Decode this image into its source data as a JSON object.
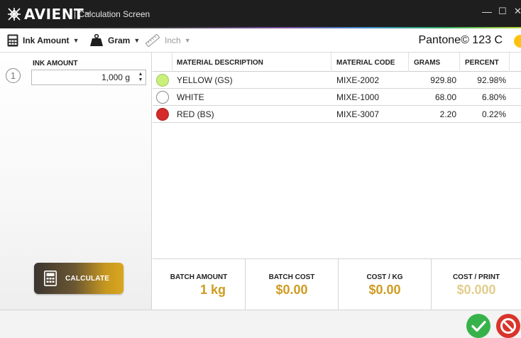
{
  "window": {
    "brand": "AVIENT",
    "trademark": "™",
    "title": "| Calculation Screen",
    "minimize_glyph": "—",
    "maximize_glyph": "☐",
    "close_glyph": "✕"
  },
  "toolbar": {
    "ink_amount_label": "Ink Amount",
    "unit_label": "Gram",
    "measure_label": "Inch",
    "pantone_label": "Pantone© 123 C",
    "pantone_color": "#ffc20e",
    "icons": [
      "calculator-icon",
      "weight-icon",
      "ruler-icon"
    ]
  },
  "left_panel": {
    "step_number": "1",
    "ink_amount_caption": "INK AMOUNT",
    "ink_amount_value": "1,000 g",
    "calculate_label": "CALCULATE"
  },
  "table": {
    "headers": {
      "description": "MATERIAL DESCRIPTION",
      "code": "MATERIAL CODE",
      "grams": "GRAMS",
      "percent": "PERCENT"
    },
    "rows": [
      {
        "color": "#c8f07a",
        "border": "#a8c860",
        "description": "YELLOW (GS)",
        "code": "MIXE-2002",
        "grams": "929.80",
        "percent": "92.98%"
      },
      {
        "color": "#ffffff",
        "border": "#8a8a8a",
        "description": "WHITE",
        "code": "MIXE-1000",
        "grams": "68.00",
        "percent": "6.80%"
      },
      {
        "color": "#d42a2a",
        "border": "#b02020",
        "description": "RED (BS)",
        "code": "MIXE-3007",
        "grams": "2.20",
        "percent": "0.22%"
      }
    ]
  },
  "summary": {
    "batch_amount_caption": "BATCH AMOUNT",
    "batch_amount_value": "1 kg",
    "batch_cost_caption": "BATCH COST",
    "batch_cost_value": "$0.00",
    "cost_kg_caption": "COST / KG",
    "cost_kg_value": "$0.00",
    "cost_print_caption": "COST / PRINT",
    "cost_print_value": "$0.000"
  },
  "footer": {
    "ok_icon": "checkmark-icon",
    "cancel_icon": "cancel-icon"
  },
  "colors": {
    "accent_gold": "#cf9b20",
    "ok_green": "#37b24a",
    "cancel_red": "#d9342b"
  }
}
